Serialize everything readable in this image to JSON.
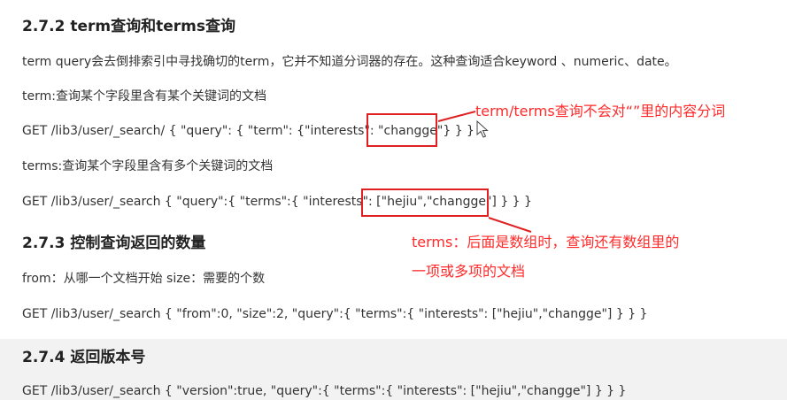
{
  "section_272": {
    "heading": "2.7.2 term查询和terms查询",
    "intro": "term query会去倒排索引中寻找确切的term，它并不知道分词器的存在。这种查询适合keyword 、numeric、date。",
    "term_label": "term:查询某个字段里含有某个关键词的文档",
    "term_query": "GET /lib3/user/_search/ { \"query\": { \"term\": {\"interests\": \"changge\"} } }",
    "terms_label": "terms:查询某个字段里含有多个关键词的文档",
    "terms_query": "GET /lib3/user/_search { \"query\":{ \"terms\":{ \"interests\": [\"hejiu\",\"changge\"] } } }"
  },
  "section_273": {
    "heading": "2.7.3 控制查询返回的数量",
    "desc": "from：从哪一个文档开始 size：需要的个数",
    "query": "GET /lib3/user/_search { \"from\":0, \"size\":2, \"query\":{ \"terms\":{ \"interests\": [\"hejiu\",\"changge\"] } } }"
  },
  "section_274": {
    "heading": "2.7.4 返回版本号",
    "query": "GET /lib3/user/_search { \"version\":true, \"query\":{ \"terms\":{ \"interests\": [\"hejiu\",\"changge\"] } } }"
  },
  "annotations": {
    "note1": "term/terms查询不会对“”里的内容分词",
    "note2_line1": "terms：后面是数组时，查询还有数组里的",
    "note2_line2": "一项或多项的文档",
    "color": "#ff2a2a"
  }
}
